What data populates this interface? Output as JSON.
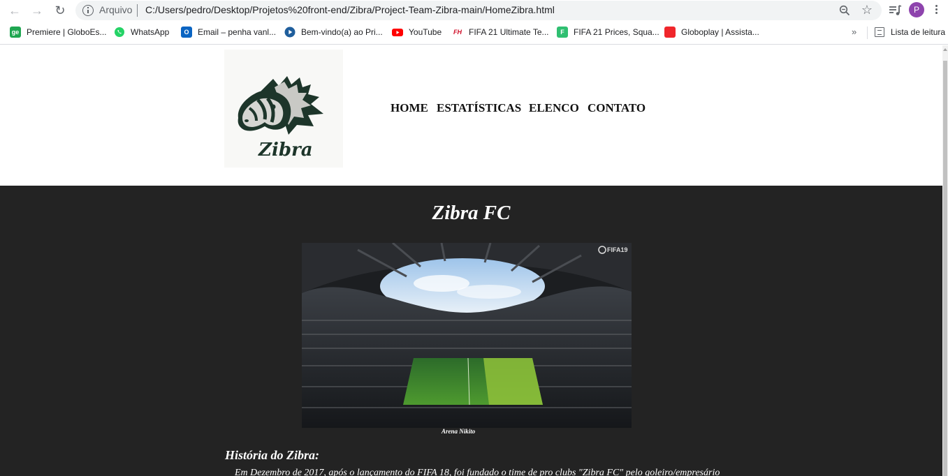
{
  "browser": {
    "scheme_label": "Arquivo",
    "url": "C:/Users/pedro/Desktop/Projetos%20front-end/Zibra/Project-Team-Zibra-main/HomeZibra.html",
    "profile_initial": "P"
  },
  "bookmarks": [
    {
      "label": "Premiere | GloboEs...",
      "icon": "globoesporte-icon",
      "fav_text": "ge",
      "color": "#1fa651"
    },
    {
      "label": "WhatsApp",
      "icon": "whatsapp-icon",
      "fav_text": "",
      "color": "#25d366"
    },
    {
      "label": "Email – penha vanl...",
      "icon": "outlook-icon",
      "fav_text": "O",
      "color": "#0a64c2"
    },
    {
      "label": "Bem-vindo(a) ao Pri...",
      "icon": "primevideo-icon",
      "fav_text": "",
      "color": "#1f5e9c"
    },
    {
      "label": "YouTube",
      "icon": "youtube-icon",
      "fav_text": "",
      "color": "#ff0000"
    },
    {
      "label": "FIFA 21 Ultimate Te...",
      "icon": "futhead-icon",
      "fav_text": "FH",
      "color": "#d0102a"
    },
    {
      "label": "FIFA 21 Prices, Squa...",
      "icon": "futbin-icon",
      "fav_text": "F",
      "color": "#2fbf71"
    },
    {
      "label": "Globoplay | Assista...",
      "icon": "globoplay-icon",
      "fav_text": "",
      "color": "#f0262b"
    }
  ],
  "reading_list_label": "Lista de leitura",
  "site": {
    "logo_text": "Zibra",
    "nav": [
      "HOME",
      "ESTATÍSTICAS",
      "ELENCO",
      "CONTATO"
    ],
    "title": "Zibra FC",
    "image_caption": "Arena Nikito",
    "image_watermark": "FIFA19",
    "history_title": "História do Zibra:",
    "history_text": "Em Dezembro de 2017, após o lançamento do FIFA 18, foi fundado o time de pro clubs \"Zibra FC\" pelo goleiro/empresário"
  }
}
